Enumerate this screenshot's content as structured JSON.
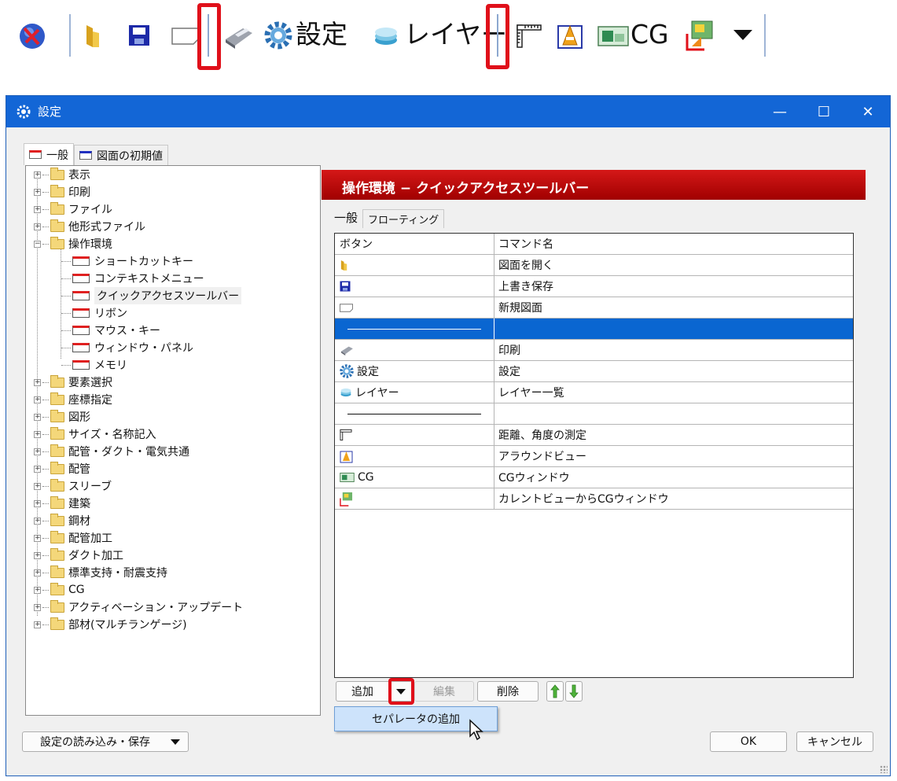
{
  "toolbar": {
    "settings_label": "設定",
    "layer_label": "レイヤー",
    "cg_label": "CG",
    "colors": {
      "highlight": "#e0101a",
      "separator": "#9fb5d6"
    }
  },
  "dialog": {
    "title": "設定",
    "window_controls": {
      "minimize": "—",
      "maximize": "☐",
      "close": "✕"
    },
    "tabs": [
      "一般",
      "図面の初期値"
    ],
    "tree": {
      "items": [
        {
          "label": "表示",
          "expanded": false
        },
        {
          "label": "印刷",
          "expanded": false
        },
        {
          "label": "ファイル",
          "expanded": false
        },
        {
          "label": "他形式ファイル",
          "expanded": false
        },
        {
          "label": "操作環境",
          "expanded": true,
          "children": [
            "ショートカットキー",
            "コンテキストメニュー",
            "クイックアクセスツールバー",
            "リボン",
            "マウス・キー",
            "ウィンドウ・パネル",
            "メモリ"
          ],
          "selected_child": "クイックアクセスツールバー"
        },
        {
          "label": "要素選択",
          "expanded": false
        },
        {
          "label": "座標指定",
          "expanded": false
        },
        {
          "label": "図形",
          "expanded": false
        },
        {
          "label": "サイズ・名称記入",
          "expanded": false
        },
        {
          "label": "配管・ダクト・電気共通",
          "expanded": false
        },
        {
          "label": "配管",
          "expanded": false
        },
        {
          "label": "スリーブ",
          "expanded": false
        },
        {
          "label": "建築",
          "expanded": false
        },
        {
          "label": "鋼材",
          "expanded": false
        },
        {
          "label": "配管加工",
          "expanded": false
        },
        {
          "label": "ダクト加工",
          "expanded": false
        },
        {
          "label": "標準支持・耐震支持",
          "expanded": false
        },
        {
          "label": "CG",
          "expanded": false
        },
        {
          "label": "アクティベーション・アップデート",
          "expanded": false
        },
        {
          "label": "部材(マルチランゲージ)",
          "expanded": false
        }
      ]
    },
    "panel": {
      "header": "操作環境 − クイックアクセスツールバー",
      "subtabs": [
        "一般",
        "フローティング"
      ],
      "grid": {
        "columns": [
          "ボタン",
          "コマンド名"
        ],
        "rows": [
          {
            "icon": "open-folder-icon",
            "button_text": "",
            "command": "図面を開く"
          },
          {
            "icon": "save-icon",
            "button_text": "",
            "command": "上書き保存"
          },
          {
            "icon": "new-drawing-icon",
            "button_text": "",
            "command": "新規図面"
          },
          {
            "icon": "separator",
            "button_text": "",
            "command": "",
            "selected": true
          },
          {
            "icon": "print-icon",
            "button_text": "",
            "command": "印刷"
          },
          {
            "icon": "gear-icon",
            "button_text": "設定",
            "command": "設定"
          },
          {
            "icon": "layer-icon",
            "button_text": "レイヤー",
            "command": "レイヤー一覧"
          },
          {
            "icon": "separator",
            "button_text": "",
            "command": ""
          },
          {
            "icon": "measure-icon",
            "button_text": "",
            "command": "距離、角度の測定"
          },
          {
            "icon": "around-view-icon",
            "button_text": "",
            "command": "アラウンドビュー"
          },
          {
            "icon": "cg-window-icon",
            "button_text": "CG",
            "command": "CGウィンドウ"
          },
          {
            "icon": "current-view-cg-icon",
            "button_text": "",
            "command": "カレントビューからCGウィンドウ"
          }
        ]
      },
      "buttons": {
        "add": "追加",
        "edit": "編集",
        "delete": "削除"
      },
      "dropdown_menu": [
        "セパレータの追加"
      ]
    },
    "footer": {
      "load_save": "設定の読み込み・保存",
      "ok": "OK",
      "cancel": "キャンセル"
    }
  }
}
